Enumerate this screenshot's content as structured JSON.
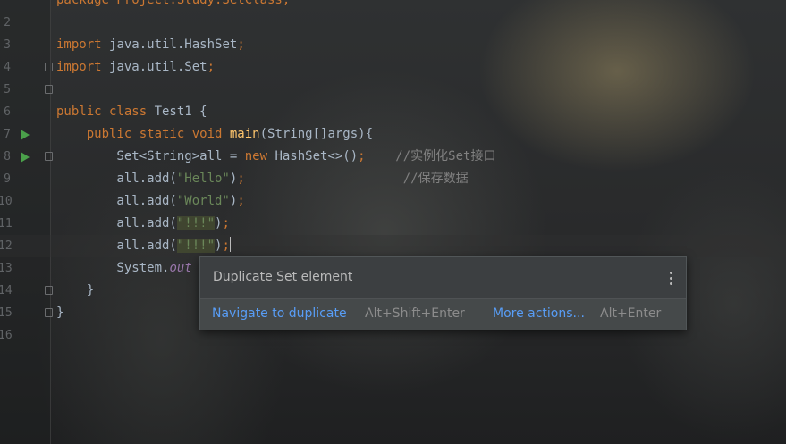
{
  "editor": {
    "lines": [
      {
        "num": "",
        "tokens": [
          {
            "t": "package Project.Study.SetClass;",
            "c": "kw"
          }
        ]
      },
      {
        "num": "2",
        "tokens": []
      },
      {
        "num": "3",
        "tokens": [
          {
            "t": "import ",
            "c": "kw"
          },
          {
            "t": "java.util.HashSet",
            "c": ""
          },
          {
            "t": ";",
            "c": "kw"
          }
        ]
      },
      {
        "num": "4",
        "tokens": [
          {
            "t": "import ",
            "c": "kw"
          },
          {
            "t": "java.util.Set",
            "c": ""
          },
          {
            "t": ";",
            "c": "kw"
          }
        ]
      },
      {
        "num": "5",
        "tokens": []
      },
      {
        "num": "6",
        "tokens": [
          {
            "t": "public class ",
            "c": "kw"
          },
          {
            "t": "Test1 {",
            "c": ""
          }
        ]
      },
      {
        "num": "7",
        "tokens": [
          {
            "t": "    public static void ",
            "c": "kw"
          },
          {
            "t": "main",
            "c": "fn"
          },
          {
            "t": "(String[]args){",
            "c": ""
          }
        ]
      },
      {
        "num": "8",
        "tokens": [
          {
            "t": "        Set<String>all = ",
            "c": ""
          },
          {
            "t": "new ",
            "c": "kw"
          },
          {
            "t": "HashSet<>()",
            "c": ""
          },
          {
            "t": ";",
            "c": "kw"
          },
          {
            "t": "    //实例化Set接口",
            "c": "cm"
          }
        ]
      },
      {
        "num": "9",
        "tokens": [
          {
            "t": "        all.add(",
            "c": ""
          },
          {
            "t": "\"Hello\"",
            "c": "str"
          },
          {
            "t": ")",
            "c": ""
          },
          {
            "t": ";",
            "c": "kw"
          },
          {
            "t": "                     //保存数据",
            "c": "cm"
          }
        ]
      },
      {
        "num": "10",
        "tokens": [
          {
            "t": "        all.add(",
            "c": ""
          },
          {
            "t": "\"World\"",
            "c": "str"
          },
          {
            "t": ")",
            "c": ""
          },
          {
            "t": ";",
            "c": "kw"
          }
        ]
      },
      {
        "num": "11",
        "tokens": [
          {
            "t": "        all.add(",
            "c": ""
          },
          {
            "t": "\"!!!\"",
            "c": "str dup"
          },
          {
            "t": ")",
            "c": ""
          },
          {
            "t": ";",
            "c": "kw"
          }
        ]
      },
      {
        "num": "12",
        "tokens": [
          {
            "t": "        all.add(",
            "c": ""
          },
          {
            "t": "\"!!!\"",
            "c": "str dup"
          },
          {
            "t": ")",
            "c": ""
          },
          {
            "t": ";",
            "c": "kw"
          },
          {
            "t": "",
            "c": "caret"
          }
        ]
      },
      {
        "num": "13",
        "tokens": [
          {
            "t": "        System.",
            "c": ""
          },
          {
            "t": "out",
            "c": "it"
          }
        ]
      },
      {
        "num": "14",
        "tokens": [
          {
            "t": "    }",
            "c": ""
          }
        ]
      },
      {
        "num": "15",
        "tokens": [
          {
            "t": "}",
            "c": ""
          }
        ]
      },
      {
        "num": "16",
        "tokens": []
      }
    ]
  },
  "popup": {
    "title": "Duplicate Set element",
    "menu_icon": "vertical-ellipsis-icon",
    "primary_action": "Navigate to duplicate",
    "primary_shortcut": "Alt+Shift+Enter",
    "more_action": "More actions...",
    "more_shortcut": "Alt+Enter"
  },
  "colors": {
    "keyword": "#cc7832",
    "string": "#6a8759",
    "comment": "#808080",
    "function": "#ffc66d",
    "link": "#589df6"
  }
}
